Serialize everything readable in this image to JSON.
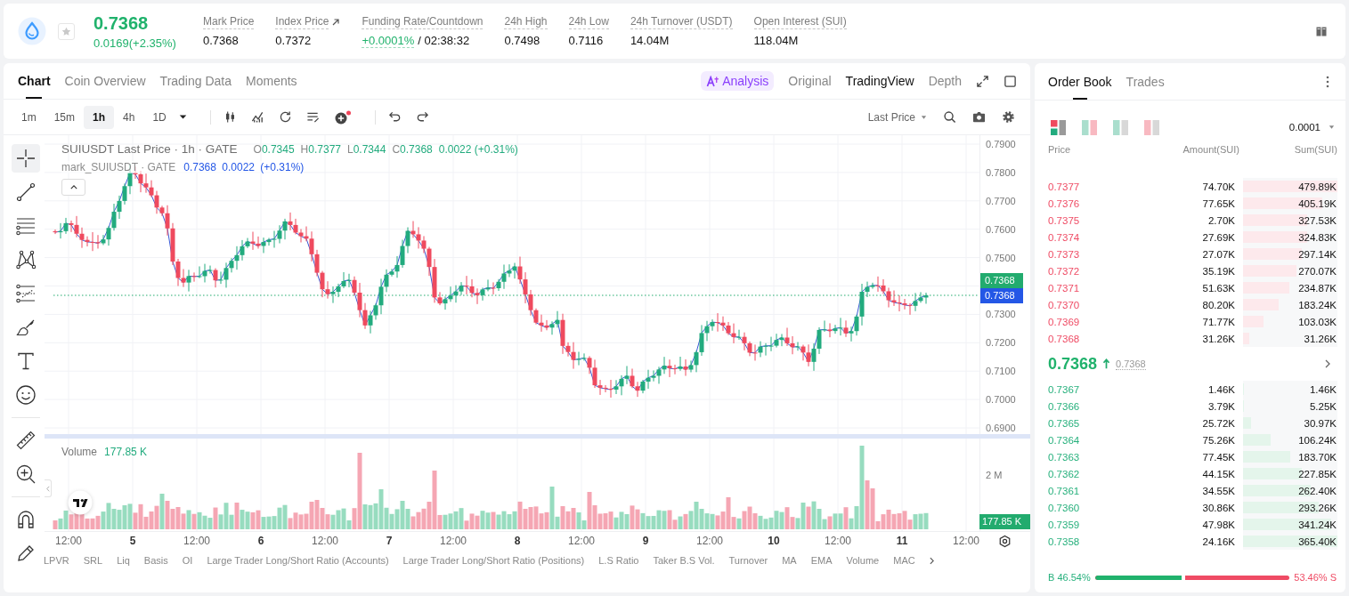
{
  "ticker": {
    "favorite": false,
    "price": "0.7368",
    "change": "0.0169(+2.35%)",
    "stats": [
      {
        "kind": "plain",
        "label": "Mark Price",
        "value": "0.7368"
      },
      {
        "kind": "link",
        "label": "Index Price",
        "value": "0.7372"
      },
      {
        "kind": "funding",
        "label": "Funding Rate/Countdown",
        "value": "+0.0001%",
        "countdown": "/ 02:38:32"
      },
      {
        "kind": "plain",
        "label": "24h High",
        "value": "0.7498"
      },
      {
        "kind": "plain",
        "label": "24h Low",
        "value": "0.7116"
      },
      {
        "kind": "plain",
        "label": "24h Turnover (USDT)",
        "value": "14.04M"
      },
      {
        "kind": "plain",
        "label": "Open Interest (SUI)",
        "value": "118.04M"
      }
    ]
  },
  "chart_panel": {
    "tabs": [
      {
        "label": "Chart",
        "selected": true
      },
      {
        "label": "Coin Overview",
        "selected": false
      },
      {
        "label": "Trading Data",
        "selected": false
      },
      {
        "label": "Moments",
        "selected": false
      }
    ],
    "views": [
      {
        "kind": "ai",
        "label": "Analysis",
        "selected": false
      },
      {
        "kind": "plain",
        "label": "Original",
        "selected": false
      },
      {
        "kind": "plain",
        "label": "TradingView",
        "selected": true
      },
      {
        "kind": "plain",
        "label": "Depth",
        "selected": false
      }
    ],
    "intervals": [
      {
        "label": "1m",
        "selected": false
      },
      {
        "label": "15m",
        "selected": false
      },
      {
        "label": "1h",
        "selected": true
      },
      {
        "label": "4h",
        "selected": false
      },
      {
        "label": "1D",
        "selected": false
      }
    ],
    "price_source": "Last Price",
    "drawing_tool_groups": [
      {
        "tools": [
          {
            "kind": "crosshair",
            "selected": true
          },
          {
            "kind": "trend_line",
            "selected": false
          },
          {
            "kind": "horizontal_lines",
            "selected": false
          },
          {
            "kind": "pattern",
            "selected": false
          },
          {
            "kind": "fib",
            "selected": false
          },
          {
            "kind": "brush",
            "selected": false
          },
          {
            "kind": "text",
            "selected": false
          },
          {
            "kind": "emoji",
            "selected": false
          }
        ]
      },
      {
        "tools": [
          {
            "kind": "ruler",
            "selected": false
          },
          {
            "kind": "zoom",
            "selected": false
          }
        ]
      },
      {
        "tools": [
          {
            "kind": "magnet",
            "selected": false
          },
          {
            "kind": "pencil",
            "selected": false
          }
        ]
      }
    ],
    "legend": {
      "title": "SUIUSDT Last Price · 1h · GATE",
      "ohlc": [
        {
          "key": "O",
          "value": "0.7345"
        },
        {
          "key": "H",
          "value": "0.7377"
        },
        {
          "key": "L",
          "value": "0.7344"
        },
        {
          "key": "C",
          "value": "0.7368"
        }
      ],
      "change": "0.0022 (+0.31%)",
      "mark_title": "mark_SUIUSDT · GATE",
      "mark_values": "0.7368 0.0022 (+0.31%)"
    },
    "price_axis": {
      "upper": [
        "0.7900",
        "0.7800",
        "0.7700",
        "0.7600",
        "0.7500"
      ],
      "lower": [
        "0.7300",
        "0.7200",
        "0.7100",
        "0.7000",
        "0.6900"
      ]
    },
    "price_badges": [
      {
        "label": "0.7368",
        "color": "#22ab6e"
      },
      {
        "label": "0.7368",
        "color": "#2457e6"
      }
    ],
    "volume": {
      "label": "Volume",
      "value": "177.85 K",
      "axis_label": "2 M",
      "badge": "177.85 K"
    },
    "time_axis": [
      {
        "label": "12:00",
        "kind": "time"
      },
      {
        "label": "5",
        "kind": "date"
      },
      {
        "label": "12:00",
        "kind": "time"
      },
      {
        "label": "6",
        "kind": "date"
      },
      {
        "label": "12:00",
        "kind": "time"
      },
      {
        "label": "7",
        "kind": "date"
      },
      {
        "label": "12:00",
        "kind": "time"
      },
      {
        "label": "8",
        "kind": "date"
      },
      {
        "label": "12:00",
        "kind": "time"
      },
      {
        "label": "9",
        "kind": "date"
      },
      {
        "label": "12:00",
        "kind": "time"
      },
      {
        "label": "10",
        "kind": "date"
      },
      {
        "label": "12:00",
        "kind": "time"
      },
      {
        "label": "11",
        "kind": "date"
      },
      {
        "label": "12:00",
        "kind": "time"
      }
    ],
    "indicators": [
      "LPVR",
      "SRL",
      "Liq",
      "Basis",
      "OI",
      "Large Trader Long/Short Ratio (Accounts)",
      "Large Trader Long/Short Ratio (Positions)",
      "L.S Ratio",
      "Taker B.S Vol.",
      "Turnover",
      "MA",
      "EMA",
      "Volume",
      "MAC"
    ]
  },
  "order_book": {
    "tabs": [
      {
        "label": "Order Book",
        "selected": true
      },
      {
        "label": "Trades",
        "selected": false
      }
    ],
    "view_modes": [
      {
        "kind": "both",
        "selected": true
      },
      {
        "kind": "split",
        "selected": false
      },
      {
        "kind": "bids",
        "selected": false
      },
      {
        "kind": "asks",
        "selected": false
      }
    ],
    "precision": "0.0001",
    "columns": [
      "Price",
      "Amount(SUI)",
      "Sum(SUI)"
    ],
    "asks": [
      {
        "price": "0.7377",
        "amount": "74.70K",
        "sum": "479.89K",
        "level": 1.0
      },
      {
        "price": "0.7376",
        "amount": "77.65K",
        "sum": "405.19K",
        "level": 0.844
      },
      {
        "price": "0.7375",
        "amount": "2.70K",
        "sum": "327.53K",
        "level": 0.683
      },
      {
        "price": "0.7374",
        "amount": "27.69K",
        "sum": "324.83K",
        "level": 0.677
      },
      {
        "price": "0.7373",
        "amount": "27.07K",
        "sum": "297.14K",
        "level": 0.619
      },
      {
        "price": "0.7372",
        "amount": "35.19K",
        "sum": "270.07K",
        "level": 0.563
      },
      {
        "price": "0.7371",
        "amount": "51.63K",
        "sum": "234.87K",
        "level": 0.489
      },
      {
        "price": "0.7370",
        "amount": "80.20K",
        "sum": "183.24K",
        "level": 0.382
      },
      {
        "price": "0.7369",
        "amount": "71.77K",
        "sum": "103.03K",
        "level": 0.215
      },
      {
        "price": "0.7368",
        "amount": "31.26K",
        "sum": "31.26K",
        "level": 0.065
      }
    ],
    "last_price": "0.7368",
    "mark_price": "0.7368",
    "bids": [
      {
        "price": "0.7367",
        "amount": "1.46K",
        "sum": "1.46K",
        "level": 0.004
      },
      {
        "price": "0.7366",
        "amount": "3.79K",
        "sum": "5.25K",
        "level": 0.014
      },
      {
        "price": "0.7365",
        "amount": "25.72K",
        "sum": "30.97K",
        "level": 0.085
      },
      {
        "price": "0.7364",
        "amount": "75.26K",
        "sum": "106.24K",
        "level": 0.291
      },
      {
        "price": "0.7363",
        "amount": "77.45K",
        "sum": "183.70K",
        "level": 0.503
      },
      {
        "price": "0.7362",
        "amount": "44.15K",
        "sum": "227.85K",
        "level": 0.624
      },
      {
        "price": "0.7361",
        "amount": "34.55K",
        "sum": "262.40K",
        "level": 0.718
      },
      {
        "price": "0.7360",
        "amount": "30.86K",
        "sum": "293.26K",
        "level": 0.803
      },
      {
        "price": "0.7359",
        "amount": "47.98K",
        "sum": "341.24K",
        "level": 0.934
      },
      {
        "price": "0.7358",
        "amount": "24.16K",
        "sum": "365.40K",
        "level": 1.0
      }
    ],
    "ratio": {
      "buy_label": "B 46.54%",
      "sell_label": "53.46% S",
      "level": 0.4654
    }
  }
}
